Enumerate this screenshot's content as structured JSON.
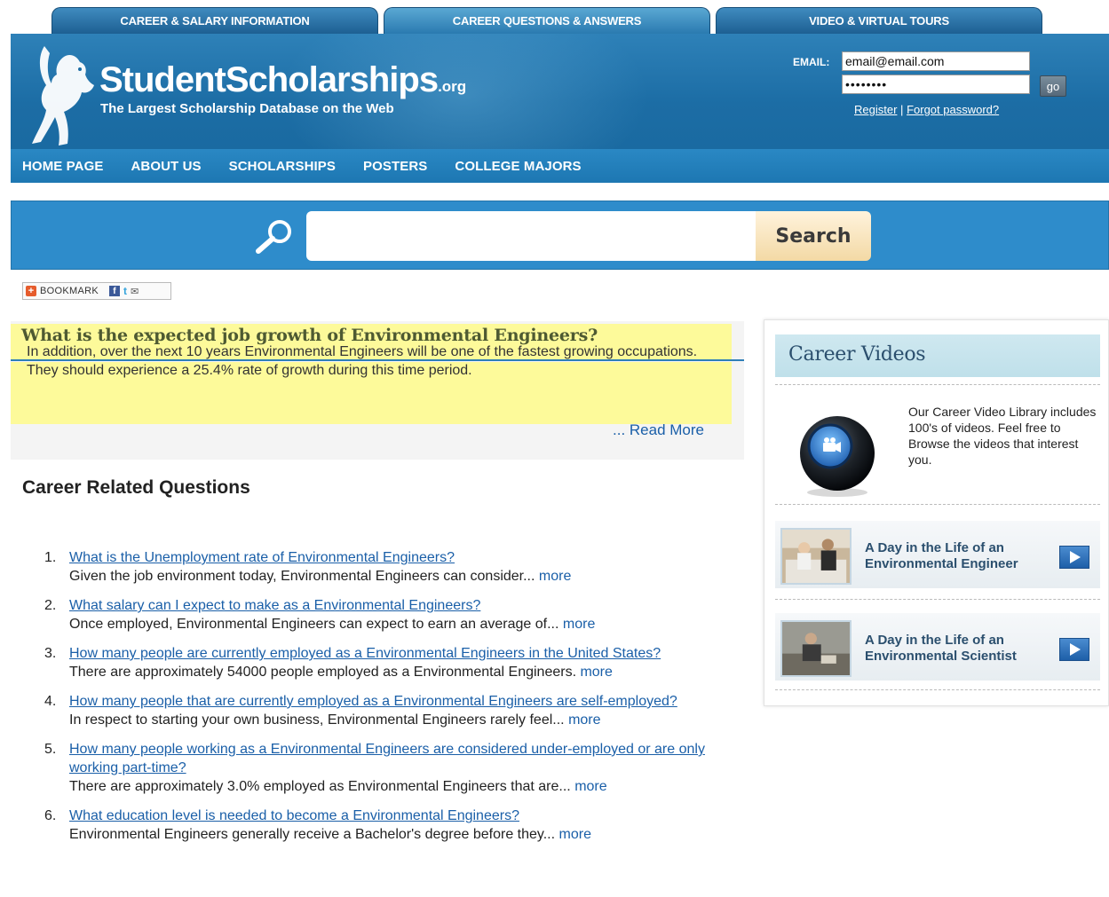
{
  "top_tabs": [
    {
      "label": "CAREER & SALARY INFORMATION"
    },
    {
      "label": "CAREER QUESTIONS & ANSWERS"
    },
    {
      "label": "VIDEO & VIRTUAL TOURS"
    }
  ],
  "logo": {
    "name": "StudentScholarships",
    "suffix": ".org",
    "tagline": "The Largest Scholarship Database on the Web"
  },
  "login": {
    "email_label": "EMAIL:",
    "email_value": "email@email.com",
    "password_value": "password",
    "go_label": "go",
    "register_label": "Register",
    "separator": "|",
    "forgot_label": "Forgot password?"
  },
  "nav": [
    {
      "label": "HOME PAGE"
    },
    {
      "label": "ABOUT US"
    },
    {
      "label": "SCHOLARSHIPS"
    },
    {
      "label": "POSTERS"
    },
    {
      "label": "COLLEGE MAJORS"
    }
  ],
  "search": {
    "value": "",
    "button_label": "Search"
  },
  "bookmark": {
    "label": "BOOKMARK"
  },
  "question": {
    "title": "What is the expected job growth of Environmental Engineers?",
    "answer": "In addition, over the next 10 years Environmental Engineers will be one of the fastest growing occupations. They should experience a 25.4% rate of growth during this time period.",
    "read_more": "... Read More"
  },
  "related": {
    "title": "Career Related Questions",
    "more_label": "more",
    "items": [
      {
        "num": "1.",
        "question": "What is the Unemployment rate of Environmental Engineers?",
        "desc": "Given the job environment today, Environmental Engineers can consider..."
      },
      {
        "num": "2.",
        "question": "What salary can I expect to make as a Environmental Engineers?",
        "desc": "Once employed, Environmental Engineers can expect to earn an average of..."
      },
      {
        "num": "3.",
        "question": "How many people are currently employed as a Environmental Engineers in the United States?",
        "desc": "There are approximately 54000 people employed as a Environmental Engineers."
      },
      {
        "num": "4.",
        "question": "How many people that are currently employed as a Environmental Engineers are self-employed?",
        "desc": "In respect to starting your own business, Environmental Engineers rarely feel..."
      },
      {
        "num": "5.",
        "question": "How many people working as a Environmental Engineers are considered under-employed or are only working part-time?",
        "desc": "There are approximately 3.0% employed as Environmental Engineers that are..."
      },
      {
        "num": "6.",
        "question": "What education level is needed to become a Environmental Engineers?",
        "desc": "Environmental Engineers generally receive a Bachelor's degree before they..."
      }
    ]
  },
  "sidebar": {
    "title": "Career Videos",
    "intro": "Our Career Video Library includes 100's of videos. Feel free to Browse the videos that interest you.",
    "videos": [
      {
        "label": "A Day in the Life of an Environmental Engineer"
      },
      {
        "label": "A Day in the Life of an Environmental Scientist"
      }
    ]
  },
  "colors": {
    "header_blue": "#1c6da5",
    "nav_blue": "#1d77b2",
    "highlight_yellow": "#fdfa9a",
    "link_blue": "#1a5fa8"
  }
}
